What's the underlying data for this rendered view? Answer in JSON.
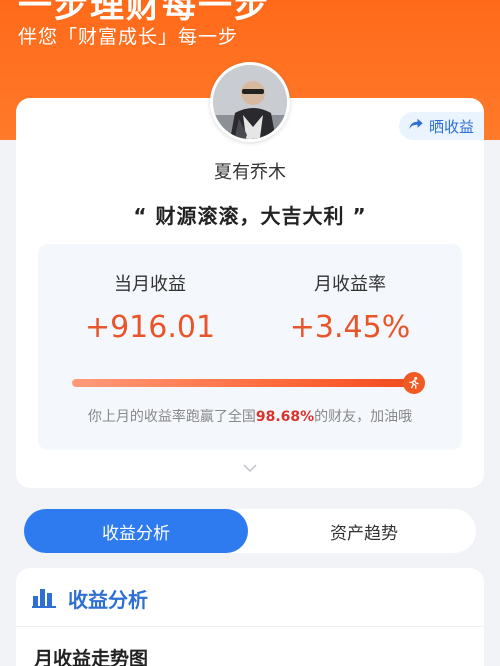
{
  "hero": {
    "title": "一步理财每一步",
    "subtitle": "伴您「财富成长」每一步"
  },
  "profile": {
    "share_label": "晒收益",
    "username": "夏有乔木",
    "slogan": "“ 财源滚滚，大吉大利 ”"
  },
  "stats": {
    "monthly_income_label": "当月收益",
    "monthly_income_value": "+916.01",
    "monthly_rate_label": "月收益率",
    "monthly_rate_value": "+3.45%",
    "progress_fraction": 0.9868,
    "rank_prefix": "你上月的收益率跑赢了全国",
    "rank_percent": "98.68%",
    "rank_suffix": "的财友，加油哦"
  },
  "tabs": [
    {
      "label": "收益分析",
      "active": true
    },
    {
      "label": "资产趋势",
      "active": false
    }
  ],
  "section": {
    "title": "收益分析",
    "subtitle": "月收益走势图"
  },
  "colors": {
    "brand_orange": "#ff6a1a",
    "accent_blue": "#2e7bf0",
    "value_red": "#e8552a",
    "highlight_red": "#d9342b"
  },
  "icons": {
    "share": "share-arrow-icon",
    "runner": "runner-icon",
    "expand": "chevron-down-icon",
    "section": "bar-chart-icon"
  }
}
